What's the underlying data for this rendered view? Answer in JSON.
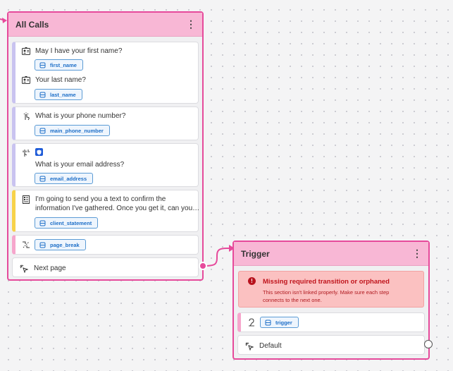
{
  "colors": {
    "node_border": "#e64a9b",
    "node_header": "#f8b7d5",
    "variable_chip": "#1e6fc8",
    "error_text": "#c0141c",
    "error_bg": "#fbc1c1"
  },
  "all_calls_node": {
    "title": "All Calls",
    "menu_icon": "⋮",
    "steps": [
      {
        "type": "question",
        "icon": "contact-card-icon",
        "text": "May I have your first name?",
        "variable": "first_name"
      },
      {
        "type": "question",
        "icon": "contact-card-icon",
        "text": "Your last name?",
        "variable": "last_name"
      },
      {
        "type": "question",
        "icon": "touch-hand-icon",
        "text": "What is your phone number?",
        "variable": "main_phone_number"
      },
      {
        "type": "question",
        "icon": "microphone-wave-icon",
        "badge_icon": "shield-badge-icon",
        "text": "What is your email address?",
        "variable": "email_address"
      },
      {
        "type": "statement",
        "icon": "document-list-icon",
        "text_line1": "I'm going to send you a text to confirm the",
        "text_line2": "information I've gathered. Once you get it, can you…",
        "variable": "client_statement"
      },
      {
        "type": "page-break",
        "icon": "page-break-icon",
        "variable": "page_break"
      }
    ],
    "footer_label": "Next page"
  },
  "trigger_node": {
    "title": "Trigger",
    "menu_icon": "⋮",
    "error": {
      "title": "Missing required transition or orphaned",
      "message": "This section isn't linked properly. Make sure each step connects to the next one."
    },
    "steps": [
      {
        "type": "trigger",
        "icon": "trigger-icon",
        "variable": "trigger"
      }
    ],
    "footer_label": "Default"
  }
}
